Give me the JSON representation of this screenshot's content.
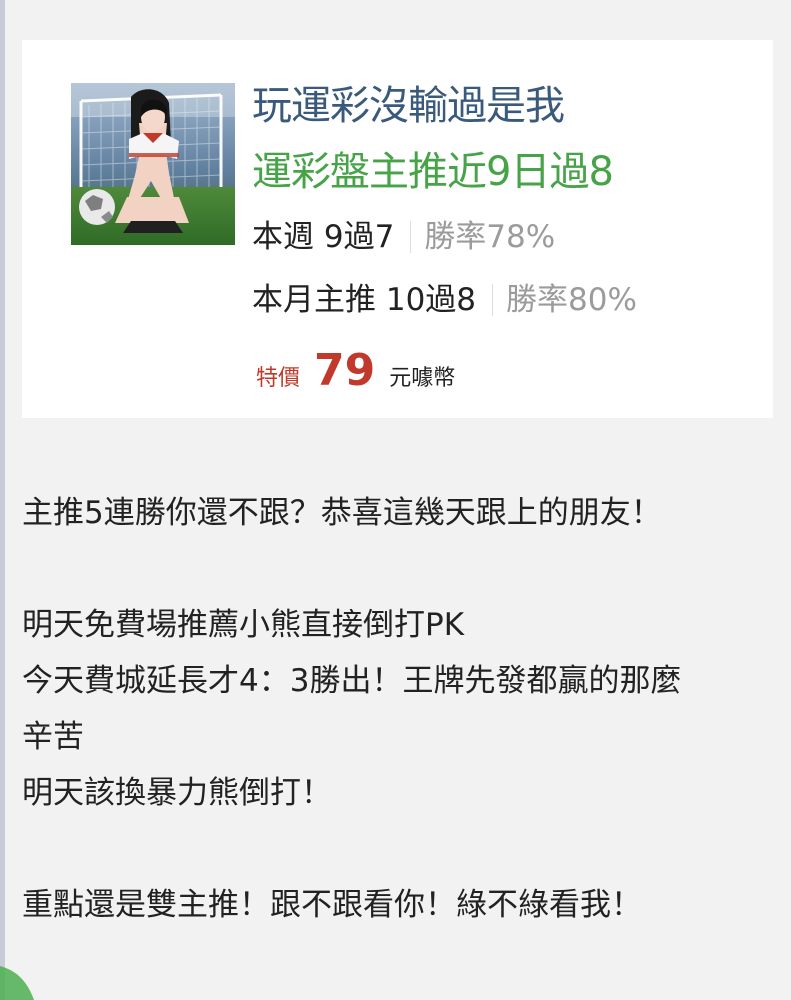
{
  "promo_card": {
    "title": "玩運彩沒輸過是我",
    "subtitle": "運彩盤主推近9日過8",
    "stats": [
      {
        "label": "本週 9過7",
        "rate": "勝率78%"
      },
      {
        "label": "本月主推 10過8",
        "rate": "勝率80%"
      }
    ],
    "price": {
      "label": "特價",
      "value": "79",
      "unit": "元噱幣"
    },
    "colors": {
      "title": "#3a5a7c",
      "subtitle": "#47a348",
      "price": "#c0392b",
      "rate": "#9b9b9b"
    }
  },
  "post": {
    "lines": [
      "主推5連勝你還不跟？恭喜這幾天跟上的朋友！",
      "",
      "明天免費場推薦小熊直接倒打PK",
      "今天費城延長才4：3勝出！王牌先發都贏的那麼",
      "辛苦",
      "明天該換暴力熊倒打！",
      "",
      "重點還是雙主推！跟不跟看你！綠不綠看我！"
    ]
  }
}
